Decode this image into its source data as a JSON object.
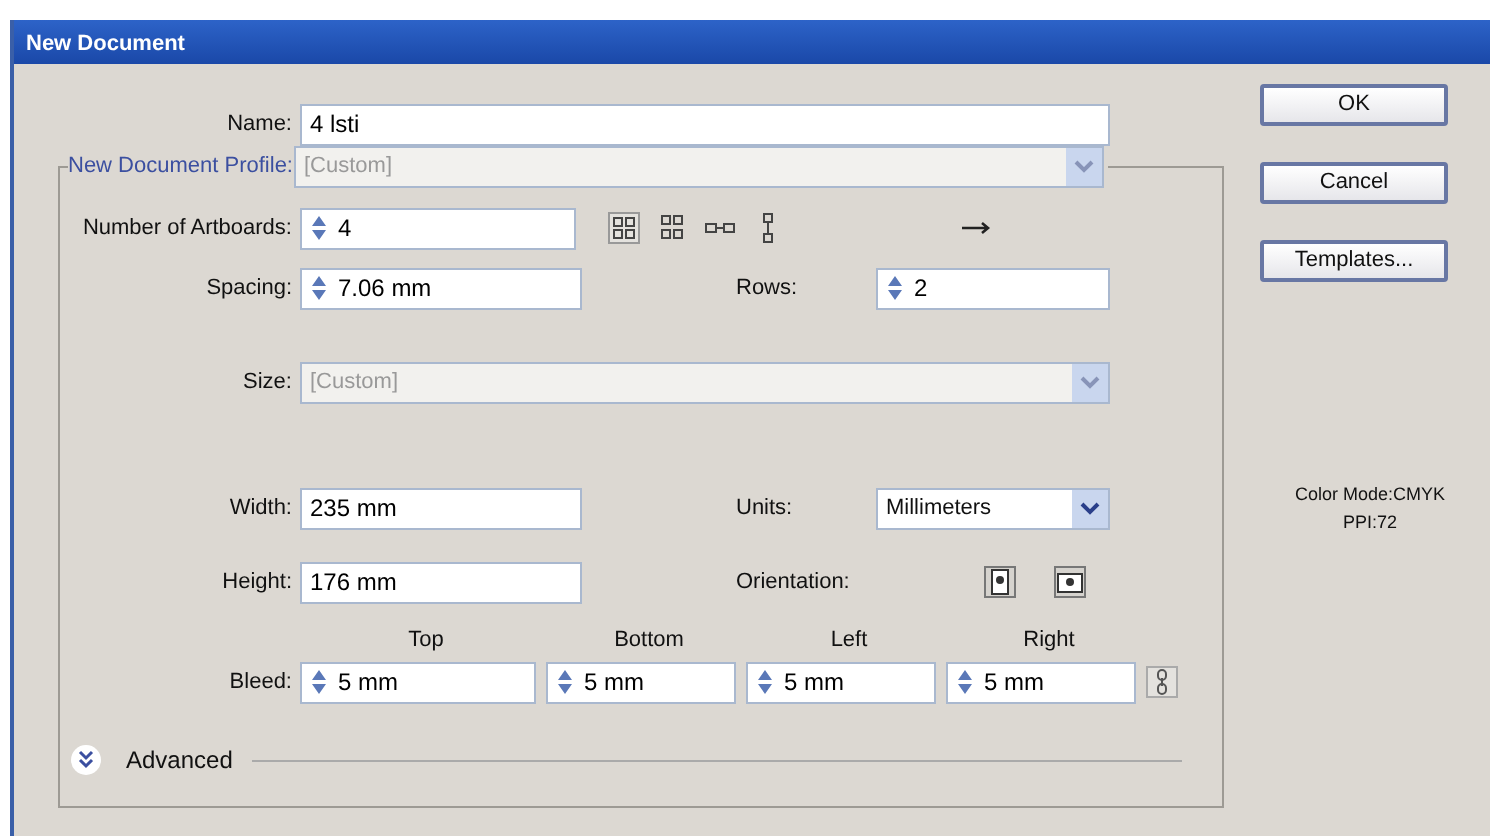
{
  "window": {
    "title": "New Document"
  },
  "name": {
    "label": "Name:",
    "value": "4 lsti"
  },
  "profile": {
    "label": "New Document Profile:",
    "value": "[Custom]",
    "disabled": true
  },
  "artboards": {
    "label": "Number of Artboards:",
    "value": "4"
  },
  "spacing": {
    "label": "Spacing:",
    "value": "7.06 mm"
  },
  "rows": {
    "label": "Rows:",
    "value": "2"
  },
  "size": {
    "label": "Size:",
    "value": "[Custom]",
    "disabled": true
  },
  "width": {
    "label": "Width:",
    "value": "235 mm"
  },
  "units": {
    "label": "Units:",
    "value": "Millimeters",
    "disabled": false
  },
  "height": {
    "label": "Height:",
    "value": "176 mm"
  },
  "orientation": {
    "label": "Orientation:"
  },
  "bleed": {
    "label": "Bleed:",
    "fields": [
      {
        "heading": "Top",
        "value": "5 mm"
      },
      {
        "heading": "Bottom",
        "value": "5 mm"
      },
      {
        "heading": "Left",
        "value": "5 mm"
      },
      {
        "heading": "Right",
        "value": "5 mm"
      }
    ]
  },
  "advanced": {
    "label": "Advanced",
    "expanded": false
  },
  "buttons": [
    "OK",
    "Cancel",
    "Templates..."
  ],
  "info": [
    "Color Mode:CMYK",
    "PPI:72"
  ]
}
